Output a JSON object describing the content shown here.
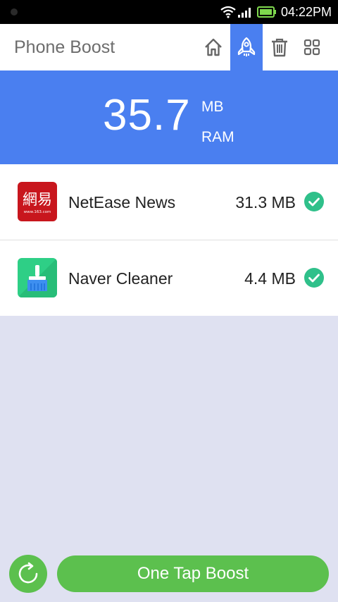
{
  "status_bar": {
    "time": "04:22PM"
  },
  "header": {
    "title": "Phone Boost",
    "buttons": [
      {
        "icon": "home-icon"
      },
      {
        "icon": "rocket-icon",
        "active": true
      },
      {
        "icon": "trash-icon"
      },
      {
        "icon": "grid-icon"
      }
    ]
  },
  "summary": {
    "value": "35.7",
    "unit": "MB",
    "label": "RAM"
  },
  "apps": [
    {
      "name": "NetEase News",
      "size": "31.3 MB",
      "icon": "netease-news-app-icon",
      "icon_text": "網易",
      "icon_sub": "www.163.com",
      "checked": true
    },
    {
      "name": "Naver Cleaner",
      "size": "4.4 MB",
      "icon": "naver-cleaner-app-icon",
      "checked": true
    }
  ],
  "bottom": {
    "boost_label": "One Tap Boost",
    "refresh_icon": "refresh-icon"
  },
  "colors": {
    "accent": "#4a7ff0",
    "green": "#5cc04e",
    "check": "#2fc08a",
    "background": "#dfe1f1"
  }
}
